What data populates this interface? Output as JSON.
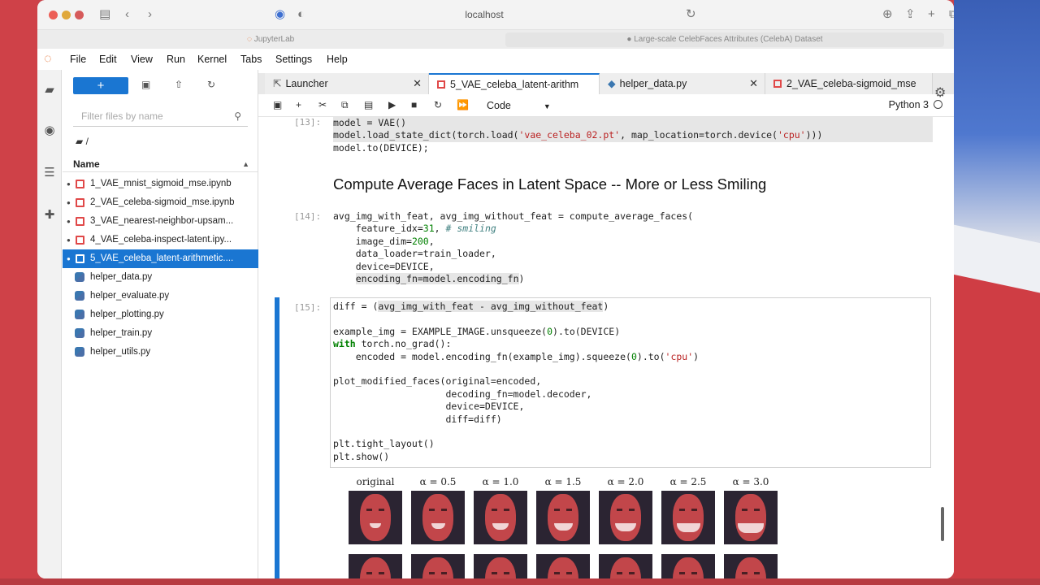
{
  "browser": {
    "url": "localhost",
    "tabs": [
      "JupyterLab",
      "Large-scale CelebFaces Attributes (CelebA) Dataset"
    ]
  },
  "menu": [
    "File",
    "Edit",
    "View",
    "Run",
    "Kernel",
    "Tabs",
    "Settings",
    "Help"
  ],
  "filebrowser": {
    "new_label": "+",
    "filter_placeholder": "Filter files by name",
    "breadcrumb": "/",
    "column_name": "Name",
    "files": [
      {
        "name": "1_VAE_mnist_sigmoid_mse.ipynb",
        "type": "notebook",
        "running": true,
        "selected": false
      },
      {
        "name": "2_VAE_celeba-sigmoid_mse.ipynb",
        "type": "notebook",
        "running": true,
        "selected": false
      },
      {
        "name": "3_VAE_nearest-neighbor-upsam...",
        "type": "notebook",
        "running": true,
        "selected": false
      },
      {
        "name": "4_VAE_celeba-inspect-latent.ipy...",
        "type": "notebook",
        "running": true,
        "selected": false
      },
      {
        "name": "5_VAE_celeba_latent-arithmetic....",
        "type": "notebook",
        "running": true,
        "selected": true
      },
      {
        "name": "helper_data.py",
        "type": "python",
        "running": false,
        "selected": false
      },
      {
        "name": "helper_evaluate.py",
        "type": "python",
        "running": false,
        "selected": false
      },
      {
        "name": "helper_plotting.py",
        "type": "python",
        "running": false,
        "selected": false
      },
      {
        "name": "helper_train.py",
        "type": "python",
        "running": false,
        "selected": false
      },
      {
        "name": "helper_utils.py",
        "type": "python",
        "running": false,
        "selected": false
      }
    ]
  },
  "doc_tabs": [
    {
      "label": "Launcher",
      "active": false
    },
    {
      "label": "5_VAE_celeba_latent-arithm",
      "active": true
    },
    {
      "label": "helper_data.py",
      "active": false
    },
    {
      "label": "2_VAE_celeba-sigmoid_mse",
      "active": false
    }
  ],
  "toolbar": {
    "cell_type": "Code",
    "kernel": "Python 3"
  },
  "cells": {
    "c13_prompt": "[13]:",
    "c14_prompt": "[14]:",
    "c15_prompt": "[15]:",
    "heading": "Compute Average Faces in Latent Space -- More or Less Smiling"
  },
  "faces": {
    "labels": [
      "original",
      "α = 0.5",
      "α = 1.0",
      "α = 1.5",
      "α = 2.0",
      "α = 2.5",
      "α = 3.0"
    ]
  },
  "colors": {
    "accent": "#1a76d2",
    "notebook_icon": "#e04848",
    "desktop": "#cf4148"
  }
}
